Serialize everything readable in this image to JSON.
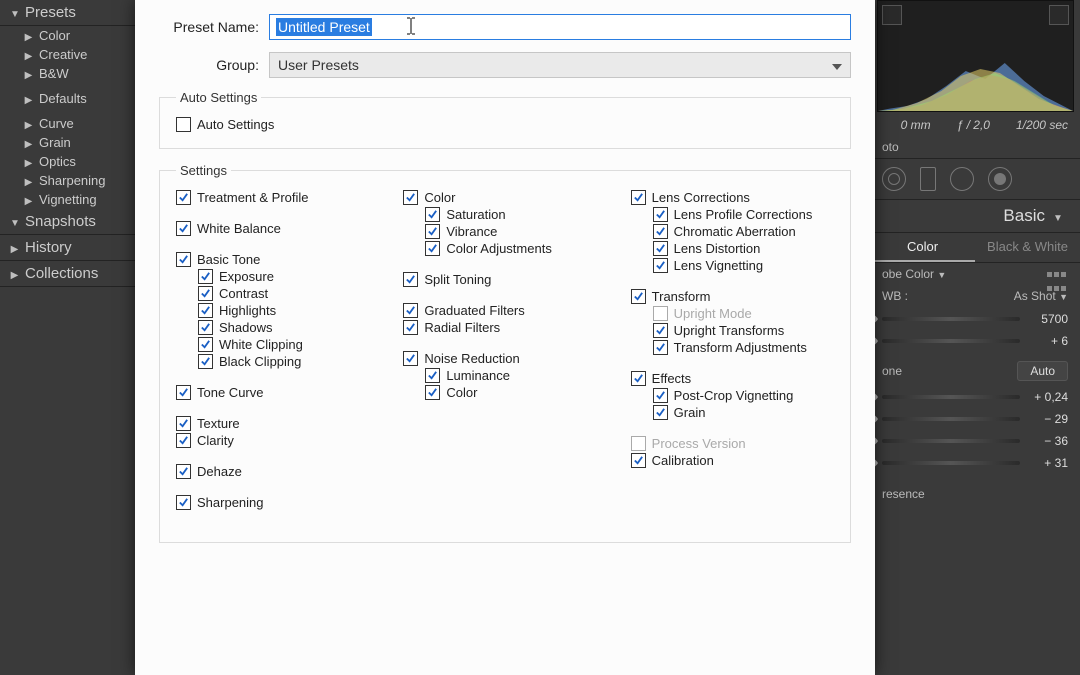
{
  "left_panel": {
    "presets_label": "Presets",
    "items_a": [
      "Color",
      "Creative",
      "B&W"
    ],
    "items_b": [
      "Defaults"
    ],
    "items_c": [
      "Curve",
      "Grain",
      "Optics",
      "Sharpening",
      "Vignetting"
    ],
    "snapshots_label": "Snapshots",
    "history_label": "History",
    "collections_label": "Collections"
  },
  "right_panel": {
    "exif": {
      "focal": "0 mm",
      "aperture": "ƒ / 2,0",
      "shutter": "1/200 sec"
    },
    "photo_label": "oto",
    "basic_label": "Basic",
    "tabs": {
      "color": "Color",
      "bw": "Black & White"
    },
    "profile_label": "obe Color",
    "wb_label": "WB :",
    "wb_value": "As Shot",
    "tone_label": "one",
    "auto_label": "Auto",
    "presence_label": "resence",
    "sliders": [
      {
        "pos": 50,
        "val": "5700"
      },
      {
        "pos": 56,
        "val": "+ 6"
      },
      {
        "pos": 58,
        "val": "+ 0,24"
      },
      {
        "pos": 38,
        "val": "− 29"
      },
      {
        "pos": 36,
        "val": "− 36"
      },
      {
        "pos": 62,
        "val": "+ 31"
      }
    ]
  },
  "dialog": {
    "preset_name_label": "Preset Name:",
    "preset_name_value": "Untitled Preset",
    "group_label": "Group:",
    "group_value": "User Presets",
    "fs_auto": "Auto Settings",
    "auto_settings_cb": "Auto Settings",
    "fs_settings": "Settings",
    "col1": [
      {
        "type": "item",
        "label": "Treatment & Profile"
      },
      {
        "type": "gap"
      },
      {
        "type": "item",
        "label": "White Balance"
      },
      {
        "type": "gap"
      },
      {
        "type": "item",
        "label": "Basic Tone"
      },
      {
        "type": "sub",
        "label": "Exposure"
      },
      {
        "type": "sub",
        "label": "Contrast"
      },
      {
        "type": "sub",
        "label": "Highlights"
      },
      {
        "type": "sub",
        "label": "Shadows"
      },
      {
        "type": "sub",
        "label": "White Clipping"
      },
      {
        "type": "sub",
        "label": "Black Clipping"
      },
      {
        "type": "gap"
      },
      {
        "type": "item",
        "label": "Tone Curve"
      },
      {
        "type": "gap"
      },
      {
        "type": "item",
        "label": "Texture"
      },
      {
        "type": "item",
        "label": "Clarity"
      },
      {
        "type": "gap"
      },
      {
        "type": "item",
        "label": "Dehaze"
      },
      {
        "type": "gap"
      },
      {
        "type": "item",
        "label": "Sharpening"
      }
    ],
    "col2": [
      {
        "type": "item",
        "label": "Color"
      },
      {
        "type": "sub",
        "label": "Saturation"
      },
      {
        "type": "sub",
        "label": "Vibrance"
      },
      {
        "type": "sub",
        "label": "Color Adjustments"
      },
      {
        "type": "gap"
      },
      {
        "type": "item",
        "label": "Split Toning"
      },
      {
        "type": "gap"
      },
      {
        "type": "item",
        "label": "Graduated Filters"
      },
      {
        "type": "item",
        "label": "Radial Filters"
      },
      {
        "type": "gap"
      },
      {
        "type": "item",
        "label": "Noise Reduction"
      },
      {
        "type": "sub",
        "label": "Luminance"
      },
      {
        "type": "sub",
        "label": "Color"
      }
    ],
    "col3": [
      {
        "type": "item",
        "label": "Lens Corrections"
      },
      {
        "type": "sub",
        "label": "Lens Profile Corrections"
      },
      {
        "type": "sub",
        "label": "Chromatic Aberration"
      },
      {
        "type": "sub",
        "label": "Lens Distortion"
      },
      {
        "type": "sub",
        "label": "Lens Vignetting"
      },
      {
        "type": "gap"
      },
      {
        "type": "item",
        "label": "Transform"
      },
      {
        "type": "sub",
        "label": "Upright Mode",
        "disabled": true,
        "unchecked": true
      },
      {
        "type": "sub",
        "label": "Upright Transforms"
      },
      {
        "type": "sub",
        "label": "Transform Adjustments"
      },
      {
        "type": "gap"
      },
      {
        "type": "item",
        "label": "Effects"
      },
      {
        "type": "sub",
        "label": "Post-Crop Vignetting"
      },
      {
        "type": "sub",
        "label": "Grain"
      },
      {
        "type": "gap"
      },
      {
        "type": "item",
        "label": "Process Version",
        "disabled": true,
        "unchecked": true
      },
      {
        "type": "item",
        "label": "Calibration"
      }
    ]
  }
}
